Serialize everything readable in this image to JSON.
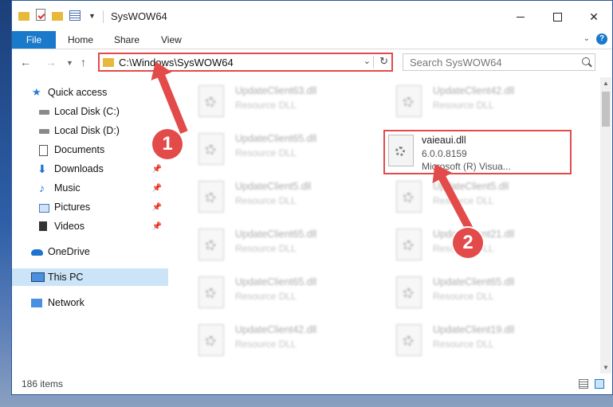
{
  "window": {
    "title": "SysWOW64"
  },
  "ribbon": {
    "tabs": [
      "File",
      "Home",
      "Share",
      "View"
    ]
  },
  "address": {
    "path": "C:\\Windows\\SysWOW64"
  },
  "search": {
    "placeholder": "Search SysWOW64"
  },
  "sidebar": {
    "items": [
      {
        "label": "Quick access",
        "icon": "star-icon"
      },
      {
        "label": "Local Disk (C:)",
        "icon": "drive-icon"
      },
      {
        "label": "Local Disk (D:)",
        "icon": "drive-icon"
      },
      {
        "label": "Documents",
        "icon": "documents-icon"
      },
      {
        "label": "Downloads",
        "icon": "download-icon"
      },
      {
        "label": "Music",
        "icon": "music-icon"
      },
      {
        "label": "Pictures",
        "icon": "pictures-icon"
      },
      {
        "label": "Videos",
        "icon": "videos-icon"
      },
      {
        "label": "OneDrive",
        "icon": "cloud-icon"
      },
      {
        "label": "This PC",
        "icon": "computer-icon"
      },
      {
        "label": "Network",
        "icon": "network-icon"
      }
    ]
  },
  "files": [
    {
      "name": "UpdateClient63.dll",
      "type": "Resource DLL"
    },
    {
      "name": "UpdateClient42.dll",
      "type": "Resource DLL"
    },
    {
      "name": "UpdateClient65.dll",
      "type": "Resource DLL"
    },
    {
      "name": "vaieaui.dll",
      "version": "6.0.0.8159",
      "description": "Microsoft (R) Visua..."
    },
    {
      "name": "UpdateClient5.dll",
      "type": "Resource DLL"
    },
    {
      "name": "UpdateClient5.dll",
      "type": "Resource DLL"
    },
    {
      "name": "UpdateClient65.dll",
      "type": "Resource DLL"
    },
    {
      "name": "UpdateClient21.dll",
      "type": "Resource DLL"
    },
    {
      "name": "UpdateClient65.dll",
      "type": "Resource DLL"
    },
    {
      "name": "UpdateClient65.dll",
      "type": "Resource DLL"
    },
    {
      "name": "UpdateClient42.dll",
      "type": "Resource DLL"
    },
    {
      "name": "UpdateClient19.dll",
      "type": "Resource DLL"
    }
  ],
  "status": {
    "item_count": "186 items"
  },
  "callouts": [
    "1",
    "2"
  ],
  "colors": {
    "accent": "#1979ca",
    "highlight": "#e34a4a"
  }
}
